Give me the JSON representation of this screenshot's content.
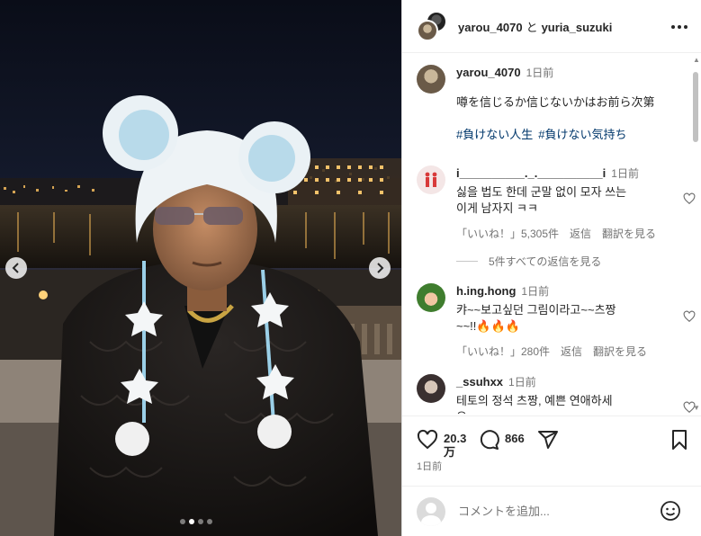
{
  "header": {
    "user1": "yarou_4070",
    "conjunction": "と",
    "user2": "yuria_suzuki"
  },
  "caption": {
    "username": "yarou_4070",
    "time": "1日前",
    "text": "噂を信じるか信じないかはお前ら次第",
    "hashtags": [
      "#負けない人生",
      "#負けない気持ち"
    ]
  },
  "comments": [
    {
      "username": "i__________._.__________i",
      "time": "1日前",
      "line1": "싫을 법도 한데 군말 없이 모자 쓰는",
      "line2": "이게 남자지 ㅋㅋ",
      "likes": "「いいね！」5,305件",
      "reply": "返信",
      "translate": "翻訳を見る"
    },
    {
      "username": "h.ing.hong",
      "time": "1日前",
      "line1": "캬~~보고싶던 그림이라고~~츠짱",
      "line2": "~~!!🔥🔥🔥",
      "likes": "「いいね！」280件",
      "reply": "返信",
      "translate": "翻訳を見る"
    },
    {
      "username": "_ssuhxx",
      "time": "1日前",
      "line1": "테토의 정석 츠짱, 예쁜 연애하세",
      "line2": "요"
    }
  ],
  "view_replies": "5件すべての返信を見る",
  "actions": {
    "likes_line1": "20.3",
    "likes_line2": "万",
    "comments_count": "866",
    "posted_time": "1日前"
  },
  "add_comment": {
    "placeholder": "コメントを追加..."
  },
  "carousel": {
    "total_slides": 4,
    "active_slide": 2
  },
  "icons": {
    "prev": "chevron-left-icon",
    "next": "chevron-right-icon",
    "more": "more-dots-icon",
    "like": "heart-icon",
    "comment": "comment-icon",
    "share": "send-icon",
    "save": "bookmark-icon",
    "emoji": "emoji-icon"
  }
}
